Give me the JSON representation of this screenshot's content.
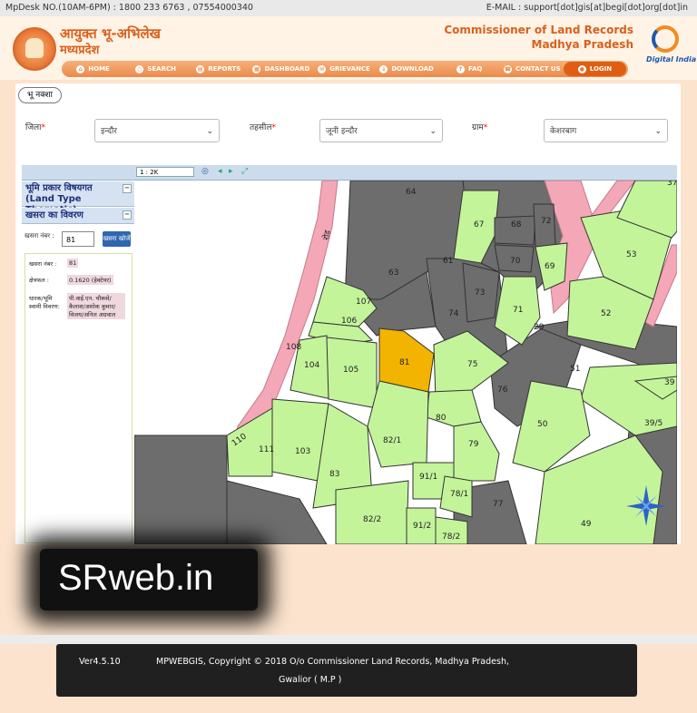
{
  "topbar": {
    "helpdesk": "MpDesk NO.(10AM-6PM) : 1800 233 6763 , 07554000340",
    "email": "E-MAIL : support[dot]gis[at]begi[dot]org[dot]in"
  },
  "header": {
    "title_hi_1": "आयुक्त भू-अभिलेख",
    "title_hi_2": "मध्यप्रदेश",
    "title_en_1": "Commissioner of Land Records",
    "title_en_2": "Madhya Pradesh",
    "digital_india": "Digital India"
  },
  "nav": [
    {
      "label": "HOME",
      "icon": "home-icon"
    },
    {
      "label": "SEARCH",
      "icon": "search-icon"
    },
    {
      "label": "REPORTS",
      "icon": "report-icon"
    },
    {
      "label": "DASHBOARD",
      "icon": "dashboard-icon"
    },
    {
      "label": "GRIEVANCE",
      "icon": "grievance-icon"
    },
    {
      "label": "DOWNLOAD",
      "icon": "download-icon"
    },
    {
      "label": "FAQ",
      "icon": "faq-icon"
    },
    {
      "label": "CONTACT US",
      "icon": "contact-icon"
    },
    {
      "label": "LOGIN",
      "icon": "login-icon"
    }
  ],
  "tab_label": "भू नक्शा",
  "filters": {
    "district_label": "जिला",
    "district_value": "इन्दौर",
    "tehsil_label": "तहसील",
    "tehsil_value": "जूनी इन्दौर",
    "village_label": "ग्राम",
    "village_value": "केशरबाग"
  },
  "toolbar": {
    "scale": "1 : 2K"
  },
  "sidebar": {
    "land_type_hi": "भूमि प्रकार विषयगत",
    "land_type_en": "(Land Type Thematic)",
    "khasra_details": "खसरा का विवरण",
    "khasra_search_label": "खसरा नंबर :",
    "khasra_search_value": "81",
    "search_button": "खसरा खोजें",
    "rows": [
      {
        "label": "खसरा नंबर :",
        "value": "81"
      },
      {
        "label": "क्षेत्रफल :",
        "value": "0.1620 (हेक्टेयर)"
      },
      {
        "label": "धारक/भूमि स्वामी विवरण:",
        "value": "पी.वाई.एन. चौकसे/कैलाश/अशोक कुमार/ विजय/अनिल अग्रवाल"
      }
    ]
  },
  "map": {
    "parcels": [
      "64",
      "67",
      "68",
      "72",
      "53",
      "63",
      "69",
      "52",
      "70",
      "73",
      "71",
      "74",
      "29",
      "107",
      "106",
      "108",
      "104",
      "105",
      "81",
      "75",
      "51",
      "76",
      "39",
      "39/5",
      "80",
      "82/1",
      "111",
      "103",
      "79",
      "50",
      "91/1",
      "83",
      "78/1",
      "77",
      "82/2",
      "91/2",
      "78/2",
      "49",
      "110",
      "106"
    ],
    "road_label": "रोड"
  },
  "watermark": "SRweb.in",
  "footer": {
    "version": "Ver4.5.10",
    "copyright": "MPWEBGIS, Copyright © 2018 O/o Commissioner Land Records, Madhya Pradesh,",
    "copyright2": "Gwalior ( M.P )"
  },
  "colors": {
    "accent": "#e98a4b",
    "parcel_green": "#c4f49a",
    "parcel_grey": "#6d6d6d",
    "road_pink": "#f4a7b6",
    "selected_parcel": "#f2b400"
  }
}
